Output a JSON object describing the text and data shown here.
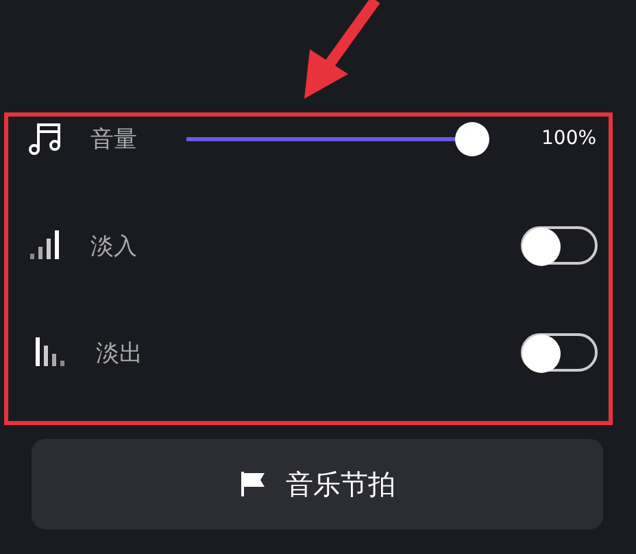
{
  "settings": [
    {
      "kind": "slider",
      "label": "音量",
      "level": 1,
      "reading": "100%"
    },
    {
      "kind": "toggle",
      "label": "淡入",
      "on": false
    },
    {
      "kind": "toggle",
      "label": "淡出",
      "on": false
    }
  ],
  "beat_button": {
    "label": "音乐节拍"
  }
}
